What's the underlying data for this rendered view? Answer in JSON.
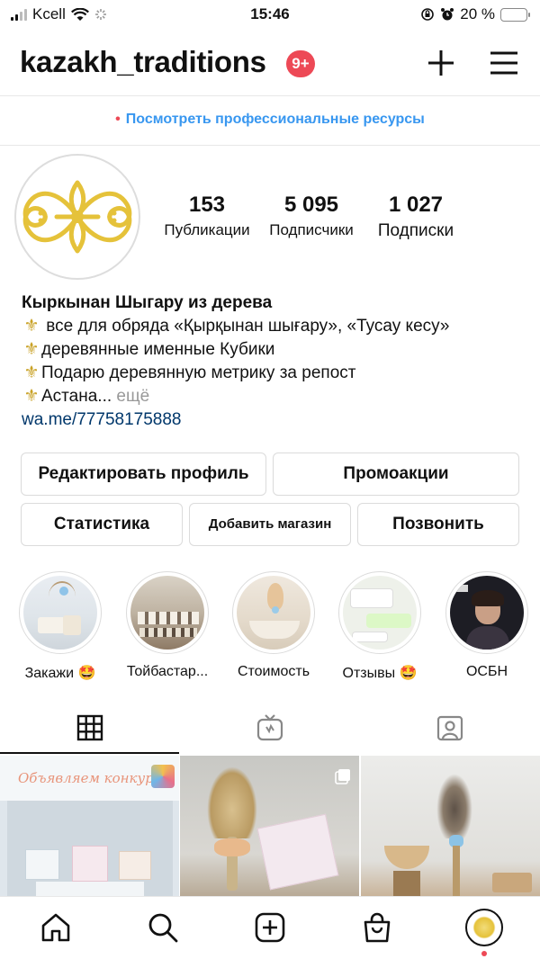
{
  "status_bar": {
    "carrier": "Kcell",
    "time": "15:46",
    "battery": "20 %",
    "battery_level": 0.2
  },
  "header": {
    "username": "kazakh_traditions",
    "notification_badge": "9+",
    "icons": [
      "plus-icon",
      "menu-icon"
    ]
  },
  "banner": {
    "bullet": "•",
    "text": "Посмотреть профессиональные ресурсы"
  },
  "profile": {
    "stats": [
      {
        "value": "153",
        "label": "Публикации"
      },
      {
        "value": "5 095",
        "label": "Подписчики"
      },
      {
        "value": "1 027",
        "label": "Подписки"
      }
    ],
    "bio": {
      "name": "Кыркынан Шыгару из дерева",
      "lines": [
        "все для обряда «Қырқынан шығару», «Тусау кесу»",
        "деревянные именные Кубики",
        "Подарю деревянную метрику за репост",
        "Астана..."
      ],
      "more": "ещё",
      "link": "wa.me/77758175888"
    }
  },
  "buttons": {
    "edit_profile": "Редактировать профиль",
    "promotions": "Промоакции",
    "insights": "Статистика",
    "add_shop": "Добавить магазин",
    "call": "Позвонить"
  },
  "highlights": [
    {
      "label": "Закажи 🤩"
    },
    {
      "label": "Тойбастар..."
    },
    {
      "label": "Стоимость"
    },
    {
      "label": "Отзывы 🤩"
    },
    {
      "label": "ОСБН"
    }
  ],
  "tabs": [
    "grid-icon",
    "igtv-icon",
    "tagged-icon"
  ],
  "posts": [
    {
      "caption": "Объявляем конкурс"
    },
    {
      "caption": ""
    },
    {
      "caption": ""
    }
  ],
  "bottom_nav": [
    "home-icon",
    "search-icon",
    "create-icon",
    "shop-icon",
    "profile-icon"
  ],
  "colors": {
    "accent_blue": "#3897f0",
    "badge_red": "#ed4956",
    "link": "#00376b",
    "logo_gold": "#e5c23a"
  }
}
